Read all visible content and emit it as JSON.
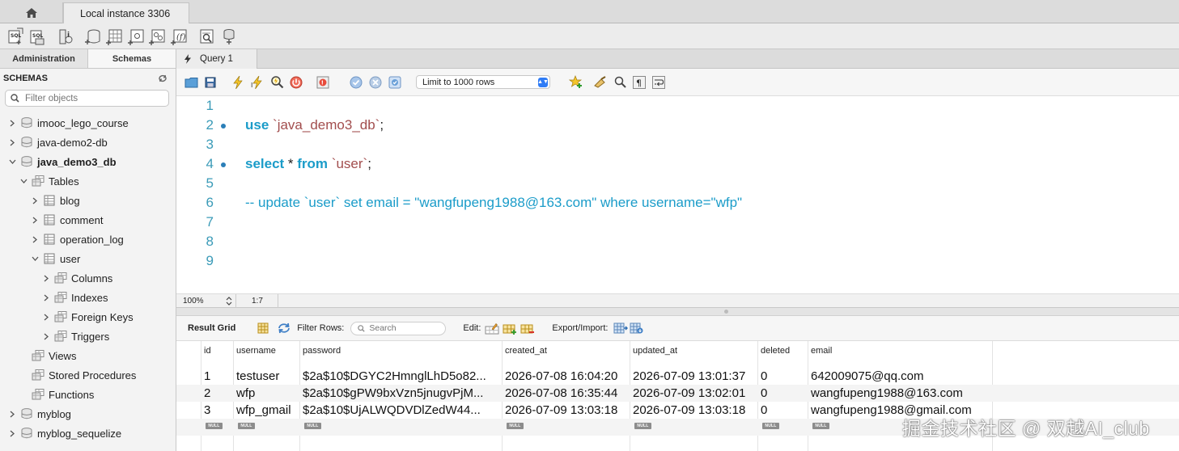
{
  "tabs": {
    "home_icon": "home-icon",
    "connection": "Local instance 3306"
  },
  "toolbar": {
    "icons": [
      "new-sql-tab-icon",
      "open-sql-script-icon",
      "open-inspector-icon",
      "create-schema-icon",
      "create-table-icon",
      "create-view-icon",
      "create-procedure-icon",
      "create-function-icon",
      "search-table-data-icon",
      "reconnect-icon"
    ]
  },
  "sidebar": {
    "tab_admin": "Administration",
    "tab_schemas": "Schemas",
    "header": "SCHEMAS",
    "filter_placeholder": "Filter objects",
    "tree": [
      {
        "label": "imooc_lego_course",
        "level": 0,
        "expanded": false,
        "icon": "database-icon"
      },
      {
        "label": "java-demo2-db",
        "level": 0,
        "expanded": false,
        "icon": "database-icon"
      },
      {
        "label": "java_demo3_db",
        "level": 0,
        "expanded": true,
        "icon": "database-icon",
        "bold": true
      },
      {
        "label": "Tables",
        "level": 1,
        "expanded": true,
        "icon": "tables-folder-icon"
      },
      {
        "label": "blog",
        "level": 2,
        "expanded": false,
        "icon": "table-icon"
      },
      {
        "label": "comment",
        "level": 2,
        "expanded": false,
        "icon": "table-icon"
      },
      {
        "label": "operation_log",
        "level": 2,
        "expanded": false,
        "icon": "table-icon"
      },
      {
        "label": "user",
        "level": 2,
        "expanded": true,
        "icon": "table-icon"
      },
      {
        "label": "Columns",
        "level": 3,
        "expanded": false,
        "icon": "columns-folder-icon"
      },
      {
        "label": "Indexes",
        "level": 3,
        "expanded": false,
        "icon": "indexes-folder-icon"
      },
      {
        "label": "Foreign Keys",
        "level": 3,
        "expanded": false,
        "icon": "foreign-keys-folder-icon"
      },
      {
        "label": "Triggers",
        "level": 3,
        "expanded": false,
        "icon": "triggers-folder-icon"
      },
      {
        "label": "Views",
        "level": 1,
        "leaf": true,
        "icon": "views-folder-icon"
      },
      {
        "label": "Stored Procedures",
        "level": 1,
        "leaf": true,
        "icon": "procedures-folder-icon"
      },
      {
        "label": "Functions",
        "level": 1,
        "leaf": true,
        "icon": "functions-folder-icon"
      },
      {
        "label": "myblog",
        "level": 0,
        "expanded": false,
        "icon": "database-icon"
      },
      {
        "label": "myblog_sequelize",
        "level": 0,
        "expanded": false,
        "icon": "database-icon"
      }
    ]
  },
  "query_tab": {
    "label": "Query 1",
    "icon": "lightning-icon"
  },
  "sql_toolbar": {
    "limit": "Limit to 1000 rows"
  },
  "editor": {
    "lines": [
      {
        "n": "1",
        "marker": false,
        "tokens": []
      },
      {
        "n": "2",
        "marker": true,
        "tokens": [
          {
            "t": "use",
            "c": "kw"
          },
          {
            "t": " ",
            "c": "op"
          },
          {
            "t": "`java_demo3_db`",
            "c": "str"
          },
          {
            "t": ";",
            "c": "op"
          }
        ]
      },
      {
        "n": "3",
        "marker": false,
        "tokens": []
      },
      {
        "n": "4",
        "marker": true,
        "tokens": [
          {
            "t": "select",
            "c": "kw"
          },
          {
            "t": " * ",
            "c": "op"
          },
          {
            "t": "from",
            "c": "kw"
          },
          {
            "t": " ",
            "c": "op"
          },
          {
            "t": "`user`",
            "c": "str"
          },
          {
            "t": ";",
            "c": "op"
          }
        ]
      },
      {
        "n": "5",
        "marker": false,
        "tokens": []
      },
      {
        "n": "6",
        "marker": false,
        "tokens": [
          {
            "t": "-- update `user` set email = \"wangfupeng1988@163.com\" where username=\"wfp\"",
            "c": "cmt"
          }
        ]
      },
      {
        "n": "7",
        "marker": false,
        "tokens": []
      },
      {
        "n": "8",
        "marker": false,
        "tokens": []
      },
      {
        "n": "9",
        "marker": false,
        "tokens": []
      }
    ],
    "zoom": "100%",
    "cursor": "1:7"
  },
  "results": {
    "label": "Result Grid",
    "filter_rows_label": "Filter Rows:",
    "search_placeholder": "Search",
    "edit_label": "Edit:",
    "export_label": "Export/Import:",
    "columns": [
      "id",
      "username",
      "password",
      "created_at",
      "updated_at",
      "deleted",
      "email"
    ],
    "rows": [
      [
        "1",
        "testuser",
        "$2a$10$DGYC2HmnglLhD5o82...",
        "2026-07-08 16:04:20",
        "2026-07-09 13:01:37",
        "0",
        "642009075@qq.com"
      ],
      [
        "2",
        "wfp",
        "$2a$10$gPW9bxVzn5jnugvPjM...",
        "2026-07-08 16:35:44",
        "2026-07-09 13:02:01",
        "0",
        "wangfupeng1988@163.com"
      ],
      [
        "3",
        "wfp_gmail",
        "$2a$10$UjALWQDVDlZedW44...",
        "2026-07-09 13:03:18",
        "2026-07-09 13:03:18",
        "0",
        "wangfupeng1988@gmail.com"
      ]
    ],
    "null_text": "NULL"
  },
  "watermark": "掘金技术社区 @ 双越AI_club"
}
